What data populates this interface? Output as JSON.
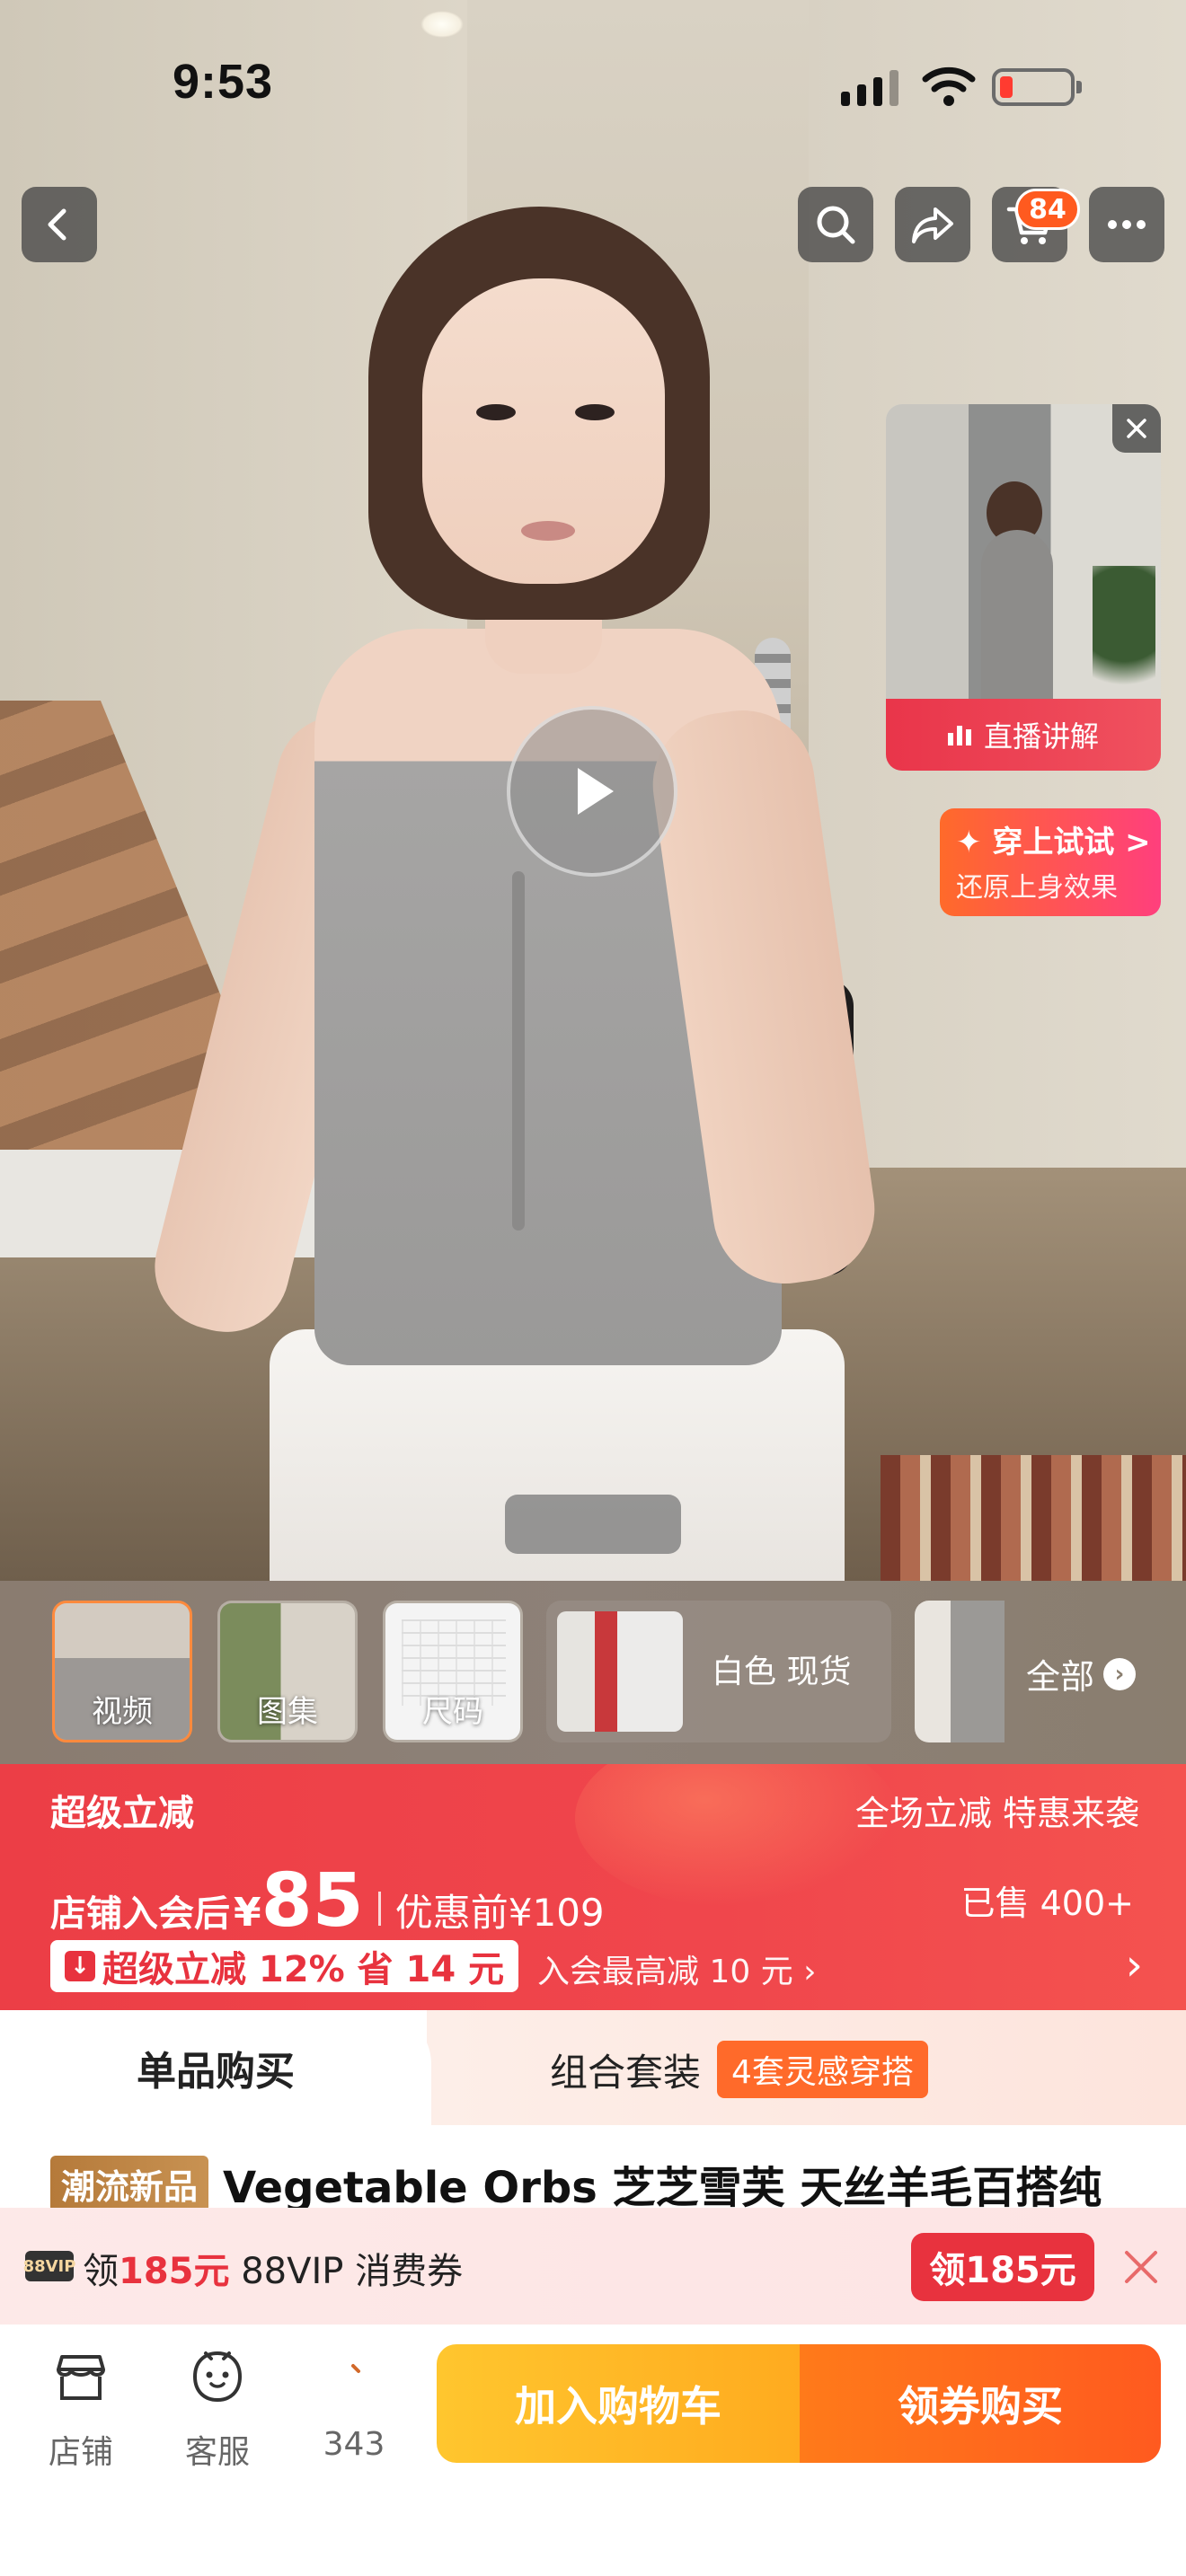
{
  "status_bar": {
    "time": "9:53"
  },
  "nav": {
    "cart_badge": "84"
  },
  "media": {
    "live_label": "直播讲解",
    "tryon_title": "✦ 穿上试试 >",
    "tryon_sub": "还原上身效果"
  },
  "thumbs": [
    {
      "label": "视频"
    },
    {
      "label": "图集"
    },
    {
      "label": "尺码"
    }
  ],
  "color_option": "白色 现货",
  "all_label": "全部",
  "price": {
    "title": "超级立减",
    "promo_right": "全场立减 特惠来袭",
    "member_prefix": "店铺入会后",
    "currency": "¥",
    "member_price": "85",
    "before_price": "优惠前¥109",
    "sold": "已售 400+",
    "discount": "超级立减 12% 省 14 元",
    "member_max": "入会最高减 10 元 ›",
    "chevron": "›"
  },
  "tabs": {
    "single": "单品购买",
    "combo": "组合套装",
    "combo_tag": "4套灵感穿搭"
  },
  "product": {
    "tag": "潮流新品",
    "title": "Vegetable Orbs 芝芝雪芙 天丝羊毛百搭纯"
  },
  "vip": {
    "logo": "88VIP",
    "pre": "领",
    "amount": "185元",
    "post": " 88VIP 消费券",
    "button": "领185元"
  },
  "bottom": {
    "store": "店铺",
    "service": "客服",
    "fav_count": "343",
    "add_cart": "加入购物车",
    "buy": "领券购买"
  },
  "colors": {
    "accent_red": "#e8323e",
    "cart_yellow": "#ffc62e",
    "buy_orange": "#ff5a1f",
    "badge_orange": "#ff5a1f"
  },
  "icons": [
    "back-icon",
    "search-icon",
    "share-icon",
    "cart-icon",
    "more-icon",
    "play-icon",
    "close-icon",
    "store-icon",
    "service-icon",
    "favorite-icon"
  ]
}
